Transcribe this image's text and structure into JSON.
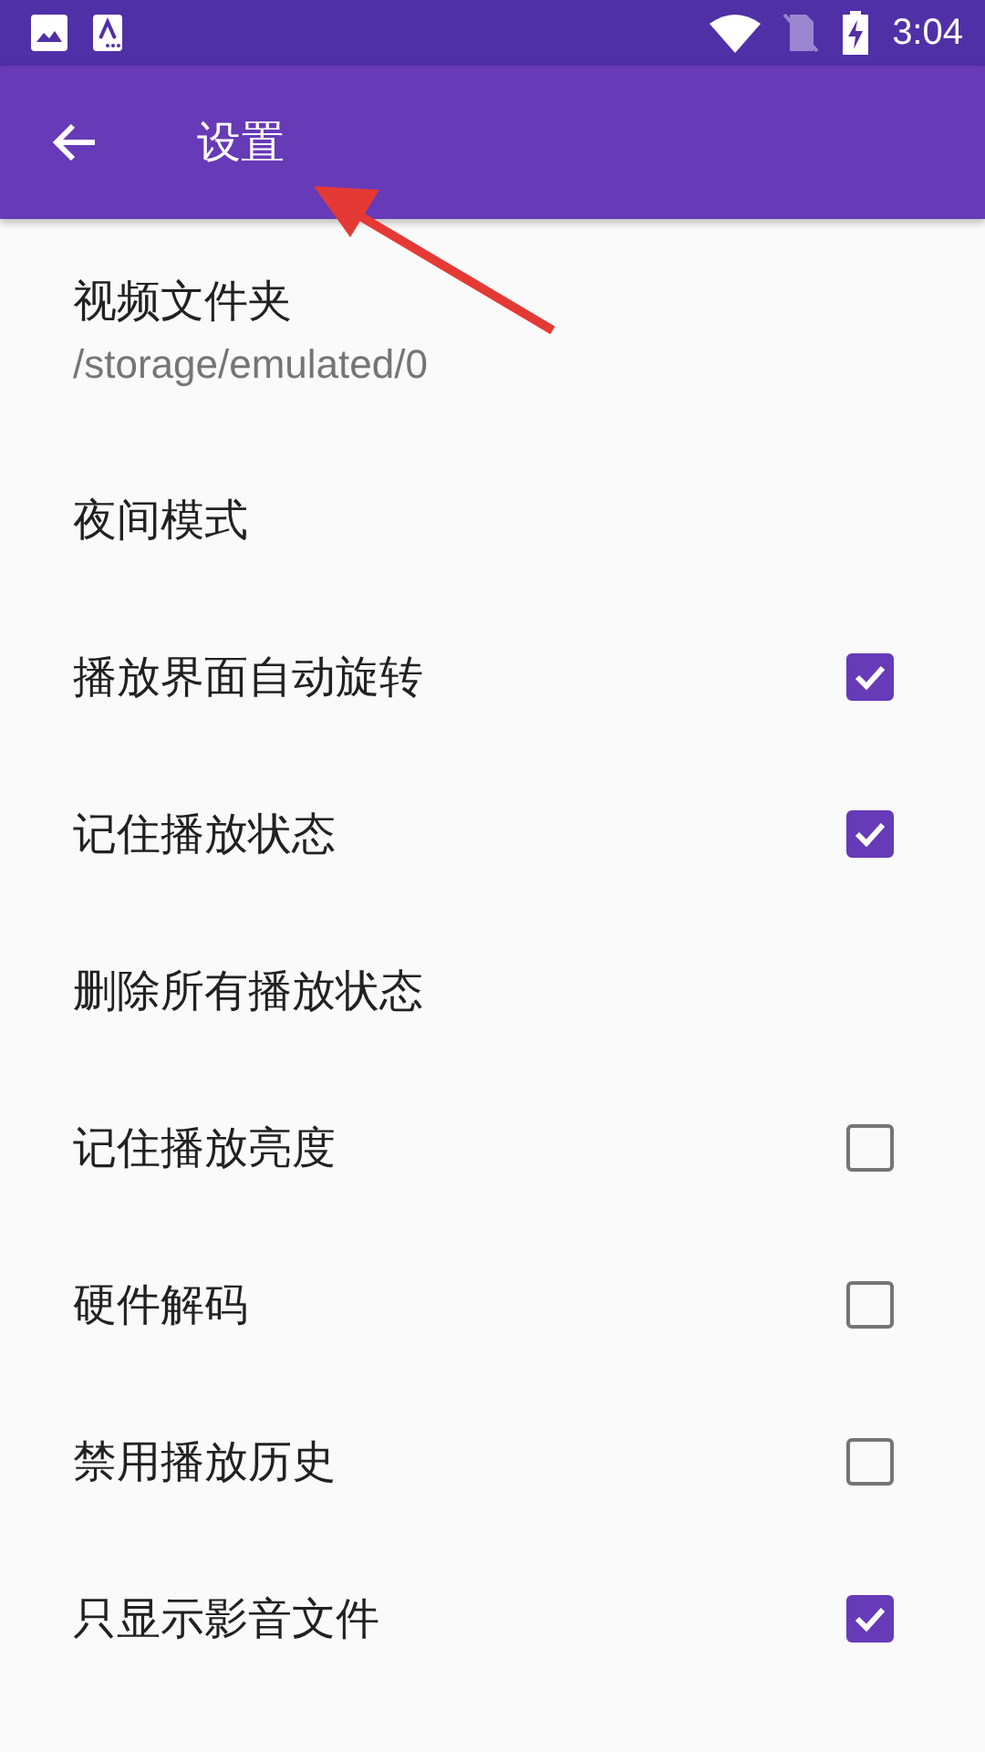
{
  "status_bar": {
    "time": "3:04"
  },
  "toolbar": {
    "title": "设置"
  },
  "settings": [
    {
      "kind": "plain",
      "title": "视频文件夹",
      "summary": "/storage/emulated/0"
    },
    {
      "kind": "plain",
      "title": "夜间模式"
    },
    {
      "kind": "checkbox",
      "title": "播放界面自动旋转",
      "checked": true
    },
    {
      "kind": "checkbox",
      "title": "记住播放状态",
      "checked": true
    },
    {
      "kind": "plain",
      "title": "删除所有播放状态"
    },
    {
      "kind": "checkbox",
      "title": "记住播放亮度",
      "checked": false
    },
    {
      "kind": "checkbox",
      "title": "硬件解码",
      "checked": false
    },
    {
      "kind": "checkbox",
      "title": "禁用播放历史",
      "checked": false
    },
    {
      "kind": "checkbox",
      "title": "只显示影音文件",
      "checked": true
    }
  ]
}
